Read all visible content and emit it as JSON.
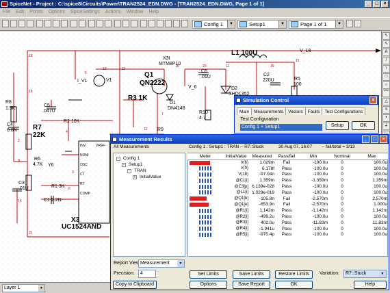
{
  "app": {
    "title": "SpiceNet - Project : C:\\spice8\\Circuits\\Power\\TRAN2524_EDN.DWG - [TRAN2524_EDN.DWG, Page 1 of 1]",
    "window_controls": [
      "_",
      "□",
      "×"
    ]
  },
  "menu": [
    "File",
    "Edit",
    "Points",
    "Options",
    "SpiceSettings",
    "Actions",
    "Window",
    "Help"
  ],
  "toolbar": {
    "config_combo": "Config 1",
    "setup_combo": "Setup1",
    "page_combo": "Page 1 of 1"
  },
  "schematic": {
    "components": {
      "l1": "L1 100U",
      "x3t": "X3t",
      "mtm": "MTM8P10",
      "q1": "Q1",
      "q2n": "QN2222",
      "r3": "R3 1K",
      "r8": "R8",
      "r8v": "1.5K",
      "c4": "C4",
      "c4v": "6.8N",
      "r7": "R7",
      "r7v": "22K",
      "c5": "C5",
      "c5v": ".047U",
      "r21": "R2 10K",
      "r6": "R6",
      "r6v": "4.7K",
      "c3": "C3",
      "c3v": ".01U",
      "r1": "R1 3K",
      "c1": "C1 2.2N",
      "x3": "X3",
      "uc": "UC1524AND",
      "d1": "D1",
      "d1v": "DN4148",
      "d2": "D2",
      "d2v": "SHD1352",
      "c2": "C2",
      "c2v": "220U",
      "r5": "R5",
      "r5v": "100",
      "c6": "C6",
      "c6v": ".01U",
      "r10": "R10",
      "r10v": "4.7",
      "r9": "R9",
      "v1": "V1",
      "i_v1": "I_V1",
      "v_18": "V_18",
      "v_6": "V_6",
      "v6": "Y6",
      "inv": "INV",
      "vref": "VREF",
      "noni": "NONI",
      "osc": "OSC",
      "ct": "CT",
      "rt": "RT",
      "comp": "COMP"
    },
    "pins": [
      "18",
      "18",
      "5",
      "10",
      "13",
      "16",
      "20",
      "11",
      "19",
      "15",
      "7",
      "12",
      "2",
      "4",
      "8",
      "3",
      "6",
      "14",
      "21"
    ]
  },
  "sim_control": {
    "title": "Simulation Control",
    "tabs": [
      "Main",
      "Measurements",
      "Vectors",
      "Faults",
      "Test Configurations"
    ],
    "test_config_label": "Test Configuration",
    "selected": "Config 1 + Setup1",
    "buttons": [
      "Setup",
      "OK"
    ]
  },
  "results": {
    "title": "Measurement Results",
    "tree_header": "All Measurements",
    "tree": [
      {
        "label": "Config 1",
        "level": 0,
        "sign": "-"
      },
      {
        "label": "Setup1",
        "level": 1,
        "sign": "-"
      },
      {
        "label": "TRAN",
        "level": 2,
        "sign": "-"
      },
      {
        "label": "InitialValue",
        "level": 3,
        "sign": "+"
      }
    ],
    "info": "Config 1 : Setup1 : TRAN -- R7::Stuck",
    "date": "30 Aug 07, 16:07",
    "fail_total": "-- fail/total = 3/13",
    "columns": [
      "Meter",
      "InitialValue",
      "Measured",
      "Pass/fail",
      "Min",
      "Nominal",
      "Max"
    ],
    "rows": [
      {
        "name": "V(6)",
        "measured": "1.029m",
        "pf": "Fail",
        "min": "-100.0u",
        "nom": "0",
        "max": "100.0u",
        "fill": 0.6,
        "fail": true
      },
      {
        "name": "V(9)",
        "measured": "6.178f",
        "pf": "Pass",
        "min": "-100.0u",
        "nom": "0",
        "max": "100.0u",
        "fill": 0.0,
        "fail": false
      },
      {
        "name": "V(18)",
        "measured": "-97.04n",
        "pf": "Pass",
        "min": "-100.0u",
        "nom": "0",
        "max": "100.0u",
        "fill": 0.0,
        "fail": false
      },
      {
        "name": "@C1[i]",
        "measured": "1.359m",
        "pf": "Pass",
        "min": "-1.359m",
        "nom": "0",
        "max": "1.359m",
        "fill": 0.0,
        "fail": false
      },
      {
        "name": "@C3[p]",
        "measured": "6.139e-028",
        "pf": "Pass",
        "min": "-100.0u",
        "nom": "0",
        "max": "100.0u",
        "fill": 0.0,
        "fail": false
      },
      {
        "name": "@L1[i]",
        "measured": "1.029e-019",
        "pf": "Pass",
        "min": "-100.0u",
        "nom": "0",
        "max": "100.0u",
        "fill": 0.0,
        "fail": false
      },
      {
        "name": "@Q1[b]",
        "measured": "-105.8n",
        "pf": "Fail",
        "min": "-2.570m",
        "nom": "0",
        "max": "2.570m",
        "fill": 0.5,
        "fail": true
      },
      {
        "name": "@Q1[e]",
        "measured": "-653.9n",
        "pf": "Fail",
        "min": "-2.570m",
        "nom": "0",
        "max": "1.000u",
        "fill": 0.55,
        "fail": true
      },
      {
        "name": "@R1[i]",
        "measured": "1.142m",
        "pf": "Pass",
        "min": "-1.142m",
        "nom": "0",
        "max": "1.142m",
        "fill": 0.0,
        "fail": false
      },
      {
        "name": "@R2[i]",
        "measured": "-499.2u",
        "pf": "Pass",
        "min": "-100.0u",
        "nom": "0",
        "max": "100.0u",
        "fill": 0.0,
        "fail": false
      },
      {
        "name": "@R3[i]",
        "measured": "402.0u",
        "pf": "Pass",
        "min": "-11.83m",
        "nom": "0",
        "max": "11.83m",
        "fill": 0.0,
        "fail": false
      },
      {
        "name": "@R4[i]",
        "measured": "-1.941u",
        "pf": "Pass",
        "min": "-100.0u",
        "nom": "0",
        "max": "100.0u",
        "fill": 0.0,
        "fail": false
      },
      {
        "name": "@R5[i]",
        "measured": "-970.4p",
        "pf": "Pass",
        "min": "-100.0u",
        "nom": "0",
        "max": "100.0u",
        "fill": 0.0,
        "fail": false
      }
    ],
    "report_view_label": "Report View:",
    "report_view_value": "Measurement",
    "precision_label": "Precision:",
    "precision_value": "4",
    "variation_label": "Variation:",
    "variation_value": "R7::Stuck",
    "buttons": {
      "copy": "Copy to Clipboard",
      "options": "Options",
      "set_limits": "Set Limits",
      "save_limits": "Save Limits",
      "restore_limits": "Restore Limits",
      "save_report": "Save Report",
      "ok": "OK",
      "help": "Help"
    }
  },
  "status": {
    "layer": "Layer 1"
  },
  "colors": {
    "fail_bar": "#e02020",
    "pass_ticks": "#2050c0",
    "titlebar": "#0a3fc0",
    "wire": "#c00000"
  }
}
